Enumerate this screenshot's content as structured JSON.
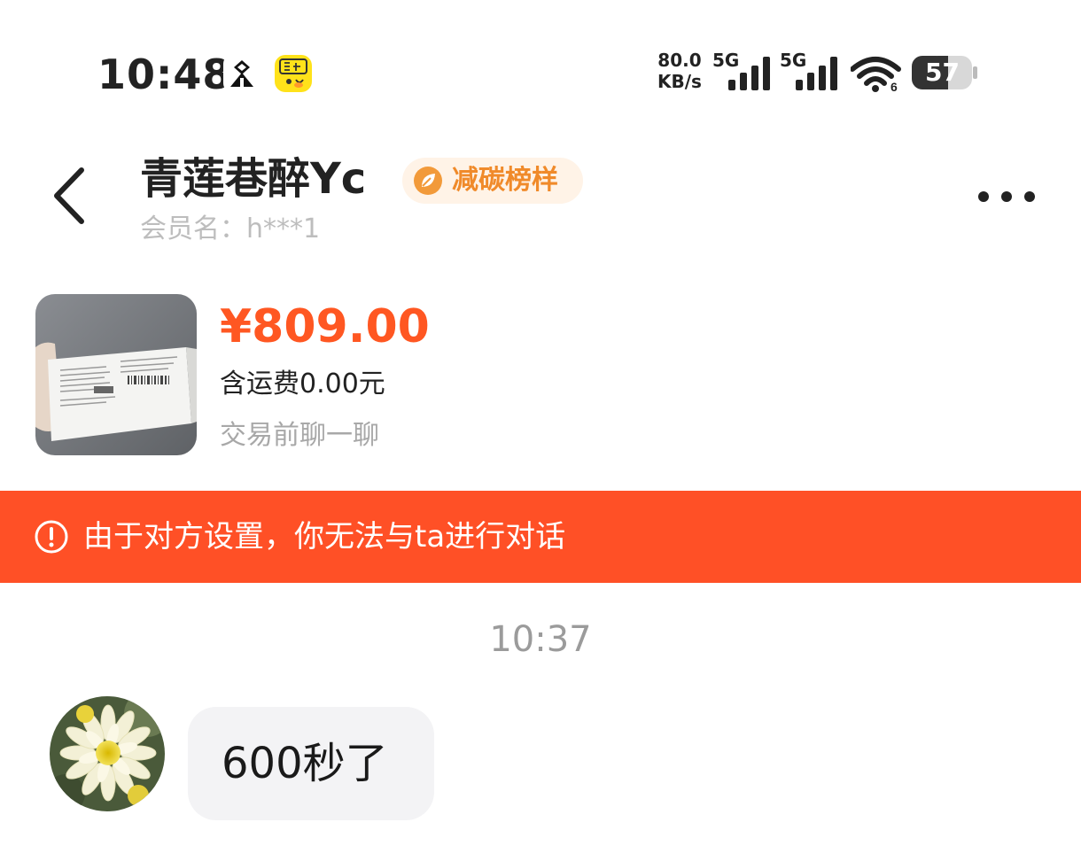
{
  "status_bar": {
    "time": "10:48",
    "net_speed_value": "80.0",
    "net_speed_unit": "KB/s",
    "sim1_label": "5G",
    "sim2_label": "5G",
    "wifi_badge": "6",
    "battery_level": "57",
    "icons": [
      "app-notification-icon",
      "xianyu-app-icon",
      "signal-icon",
      "signal-icon",
      "wifi-icon",
      "battery-icon"
    ]
  },
  "header": {
    "title": "青莲巷醉Yc",
    "badge_label": "减碳榜样",
    "member_label": "会员名：h***1",
    "back_icon": "chevron-left-icon",
    "more_icon": "more-dots-icon"
  },
  "product": {
    "price": "¥809.00",
    "shipping": "含运费0.00元",
    "chat_hint": "交易前聊一聊"
  },
  "banner": {
    "text": "由于对方设置，你无法与ta进行对话",
    "icon": "alert-circle-icon"
  },
  "chat": {
    "timestamp": "10:37",
    "messages": [
      {
        "sender": "other",
        "text": "600秒了"
      }
    ]
  },
  "colors": {
    "accent": "#ff5722",
    "banner": "#ff5026",
    "badge_text": "#f08a2a",
    "badge_bg": "#fff3e7",
    "bubble_bg": "#f3f3f5"
  }
}
